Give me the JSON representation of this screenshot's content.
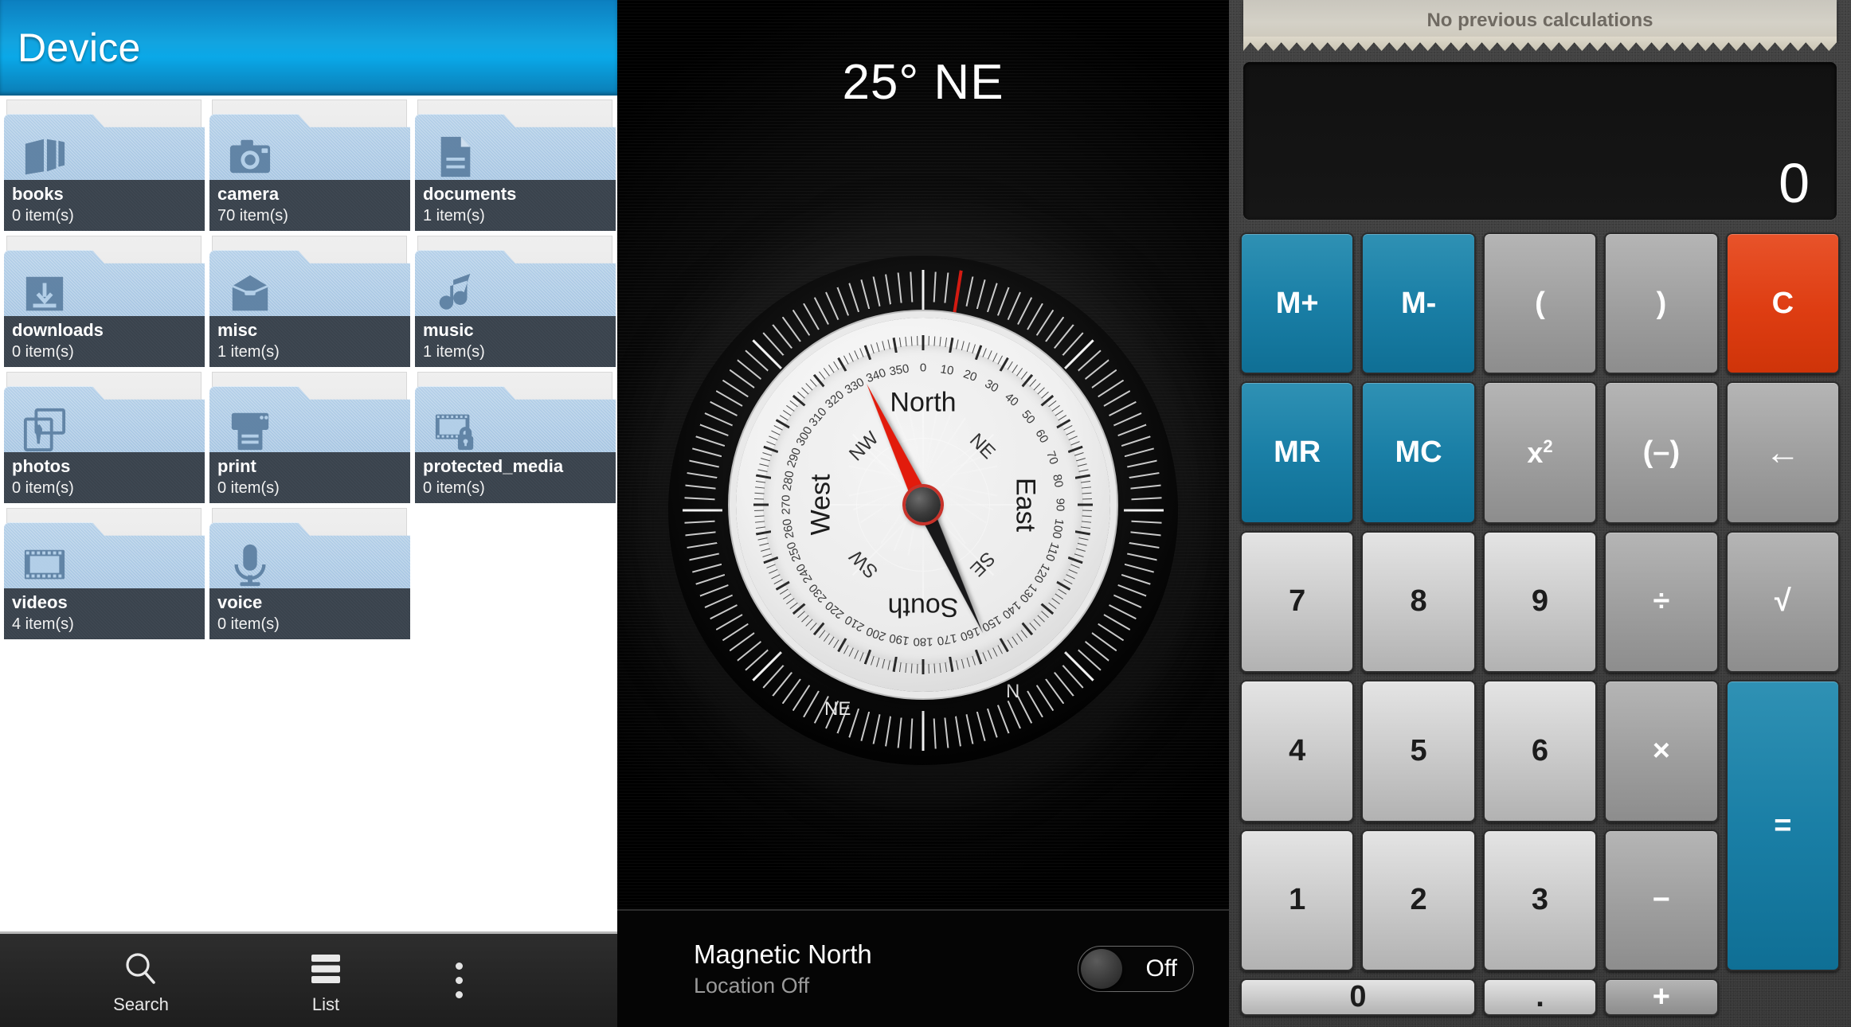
{
  "file_manager": {
    "title": "Device",
    "folders": [
      {
        "name": "books",
        "count": "0 item(s)",
        "icon": "book-icon"
      },
      {
        "name": "camera",
        "count": "70 item(s)",
        "icon": "camera-icon"
      },
      {
        "name": "documents",
        "count": "1 item(s)",
        "icon": "document-icon"
      },
      {
        "name": "downloads",
        "count": "0 item(s)",
        "icon": "download-icon"
      },
      {
        "name": "misc",
        "count": "1 item(s)",
        "icon": "box-icon"
      },
      {
        "name": "music",
        "count": "1 item(s)",
        "icon": "music-note-icon"
      },
      {
        "name": "photos",
        "count": "0 item(s)",
        "icon": "photos-icon"
      },
      {
        "name": "print",
        "count": "0 item(s)",
        "icon": "printer-icon"
      },
      {
        "name": "protected_media",
        "count": "0 item(s)",
        "icon": "locked-film-icon"
      },
      {
        "name": "videos",
        "count": "4 item(s)",
        "icon": "film-icon"
      },
      {
        "name": "voice",
        "count": "0 item(s)",
        "icon": "microphone-icon"
      }
    ],
    "toolbar": {
      "search_label": "Search",
      "list_label": "List",
      "overflow_label": "More options"
    },
    "colors": {
      "header_accent": "#0aa8e8",
      "label_bg": "#39424c",
      "folder": "#a8c7e3"
    }
  },
  "compass": {
    "heading": "25° NE",
    "heading_degrees": 25,
    "heading_cardinal": "NE",
    "dial": {
      "cardinals_major": [
        "North",
        "East",
        "South",
        "West"
      ],
      "cardinals_minor": [
        "NE",
        "SE",
        "SW",
        "NW"
      ],
      "degree_labels": [
        "0",
        "10",
        "20",
        "30",
        "40",
        "50",
        "60",
        "70",
        "80",
        "90",
        "100",
        "110",
        "120",
        "130",
        "140",
        "150",
        "160",
        "170",
        "180",
        "190",
        "200",
        "210",
        "220",
        "230",
        "240",
        "250",
        "260",
        "270",
        "280",
        "290",
        "300",
        "310",
        "320",
        "330",
        "340",
        "350"
      ]
    },
    "bezel": {
      "labels": [
        "N",
        "NE"
      ],
      "red_mark_label": "N"
    },
    "footer": {
      "title": "Magnetic North",
      "subtitle": "Location Off",
      "toggle_label": "Off",
      "toggle_state": "off"
    }
  },
  "calculator": {
    "tape_message": "No previous calculations",
    "display_value": "0",
    "keys": [
      {
        "label": "M+",
        "name": "memory-add-button",
        "style": "k-teal"
      },
      {
        "label": "M-",
        "name": "memory-subtract-button",
        "style": "k-teal"
      },
      {
        "label": "(",
        "name": "open-paren-button",
        "style": "k-grayop"
      },
      {
        "label": ")",
        "name": "close-paren-button",
        "style": "k-grayop"
      },
      {
        "label": "C",
        "name": "clear-button",
        "style": "k-red"
      },
      {
        "label": "MR",
        "name": "memory-recall-button",
        "style": "k-teal"
      },
      {
        "label": "MC",
        "name": "memory-clear-button",
        "style": "k-teal"
      },
      {
        "label": "x²",
        "name": "square-button",
        "style": "k-grayop"
      },
      {
        "label": "(–)",
        "name": "negate-button",
        "style": "k-grayop"
      },
      {
        "label": "←",
        "name": "backspace-button",
        "style": "k-grayop"
      },
      {
        "label": "7",
        "name": "digit-7-button",
        "style": "k-num"
      },
      {
        "label": "8",
        "name": "digit-8-button",
        "style": "k-num"
      },
      {
        "label": "9",
        "name": "digit-9-button",
        "style": "k-num"
      },
      {
        "label": "÷",
        "name": "divide-button",
        "style": "k-grayop"
      },
      {
        "label": "√",
        "name": "square-root-button",
        "style": "k-grayop"
      },
      {
        "label": "4",
        "name": "digit-4-button",
        "style": "k-num"
      },
      {
        "label": "5",
        "name": "digit-5-button",
        "style": "k-num"
      },
      {
        "label": "6",
        "name": "digit-6-button",
        "style": "k-num"
      },
      {
        "label": "×",
        "name": "multiply-button",
        "style": "k-grayop"
      },
      {
        "label": "=",
        "name": "equals-button",
        "style": "k-eq"
      },
      {
        "label": "1",
        "name": "digit-1-button",
        "style": "k-num"
      },
      {
        "label": "2",
        "name": "digit-2-button",
        "style": "k-num"
      },
      {
        "label": "3",
        "name": "digit-3-button",
        "style": "k-num"
      },
      {
        "label": "−",
        "name": "subtract-button",
        "style": "k-grayop"
      },
      {
        "label": "0",
        "name": "digit-0-button",
        "style": "k-num k-zero"
      },
      {
        "label": ".",
        "name": "decimal-point-button",
        "style": "k-num"
      },
      {
        "label": "+",
        "name": "add-button",
        "style": "k-grayop"
      }
    ],
    "colors": {
      "memory_key": "#1a7fa6",
      "clear_key": "#de3d12",
      "number_key": "#c9c9c9",
      "operator_key": "#9e9e9e"
    }
  }
}
